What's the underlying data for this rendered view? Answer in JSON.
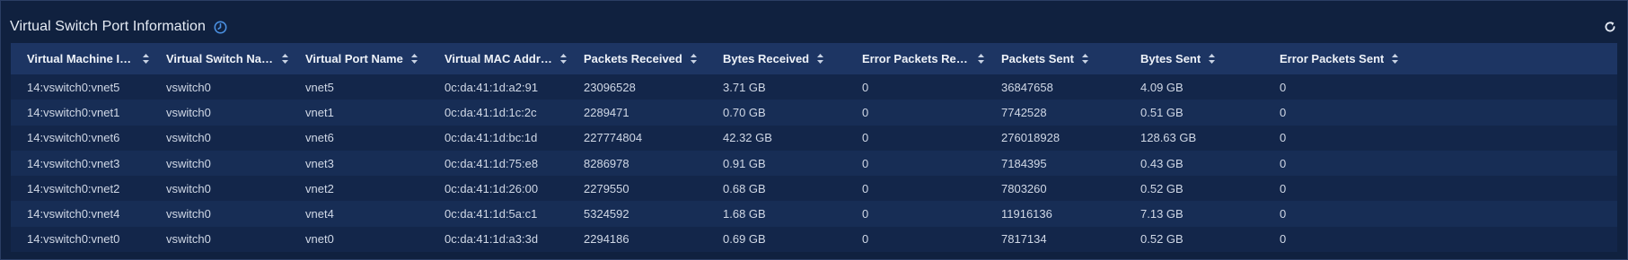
{
  "panel": {
    "title": "Virtual Switch Port Information"
  },
  "icons": {
    "clock": "clock-icon",
    "refresh": "refresh-icon",
    "sort": "sort-icon"
  },
  "table": {
    "columns": [
      "Virtual Machine ID:...",
      "Virtual Switch Name",
      "Virtual Port Name",
      "Virtual MAC Address",
      "Packets Received",
      "Bytes Received",
      "Error Packets Recei...",
      "Packets Sent",
      "Bytes Sent",
      "Error Packets Sent"
    ],
    "rows": [
      [
        "14:vswitch0:vnet5",
        "vswitch0",
        "vnet5",
        "0c:da:41:1d:a2:91",
        "23096528",
        "3.71 GB",
        "0",
        "36847658",
        "4.09 GB",
        "0"
      ],
      [
        "14:vswitch0:vnet1",
        "vswitch0",
        "vnet1",
        "0c:da:41:1d:1c:2c",
        "2289471",
        "0.70 GB",
        "0",
        "7742528",
        "0.51 GB",
        "0"
      ],
      [
        "14:vswitch0:vnet6",
        "vswitch0",
        "vnet6",
        "0c:da:41:1d:bc:1d",
        "227774804",
        "42.32 GB",
        "0",
        "276018928",
        "128.63 GB",
        "0"
      ],
      [
        "14:vswitch0:vnet3",
        "vswitch0",
        "vnet3",
        "0c:da:41:1d:75:e8",
        "8286978",
        "0.91 GB",
        "0",
        "7184395",
        "0.43 GB",
        "0"
      ],
      [
        "14:vswitch0:vnet2",
        "vswitch0",
        "vnet2",
        "0c:da:41:1d:26:00",
        "2279550",
        "0.68 GB",
        "0",
        "7803260",
        "0.52 GB",
        "0"
      ],
      [
        "14:vswitch0:vnet4",
        "vswitch0",
        "vnet4",
        "0c:da:41:1d:5a:c1",
        "5324592",
        "1.68 GB",
        "0",
        "11916136",
        "7.13 GB",
        "0"
      ],
      [
        "14:vswitch0:vnet0",
        "vswitch0",
        "vnet0",
        "0c:da:41:1d:a3:3d",
        "2294186",
        "0.69 GB",
        "0",
        "7817134",
        "0.52 GB",
        "0"
      ]
    ]
  },
  "colors": {
    "background": "#0f1f3d",
    "header": "#1d3563",
    "row_odd": "#13264a",
    "row_even": "#172d55",
    "accent_icon": "#4a8fe0"
  }
}
